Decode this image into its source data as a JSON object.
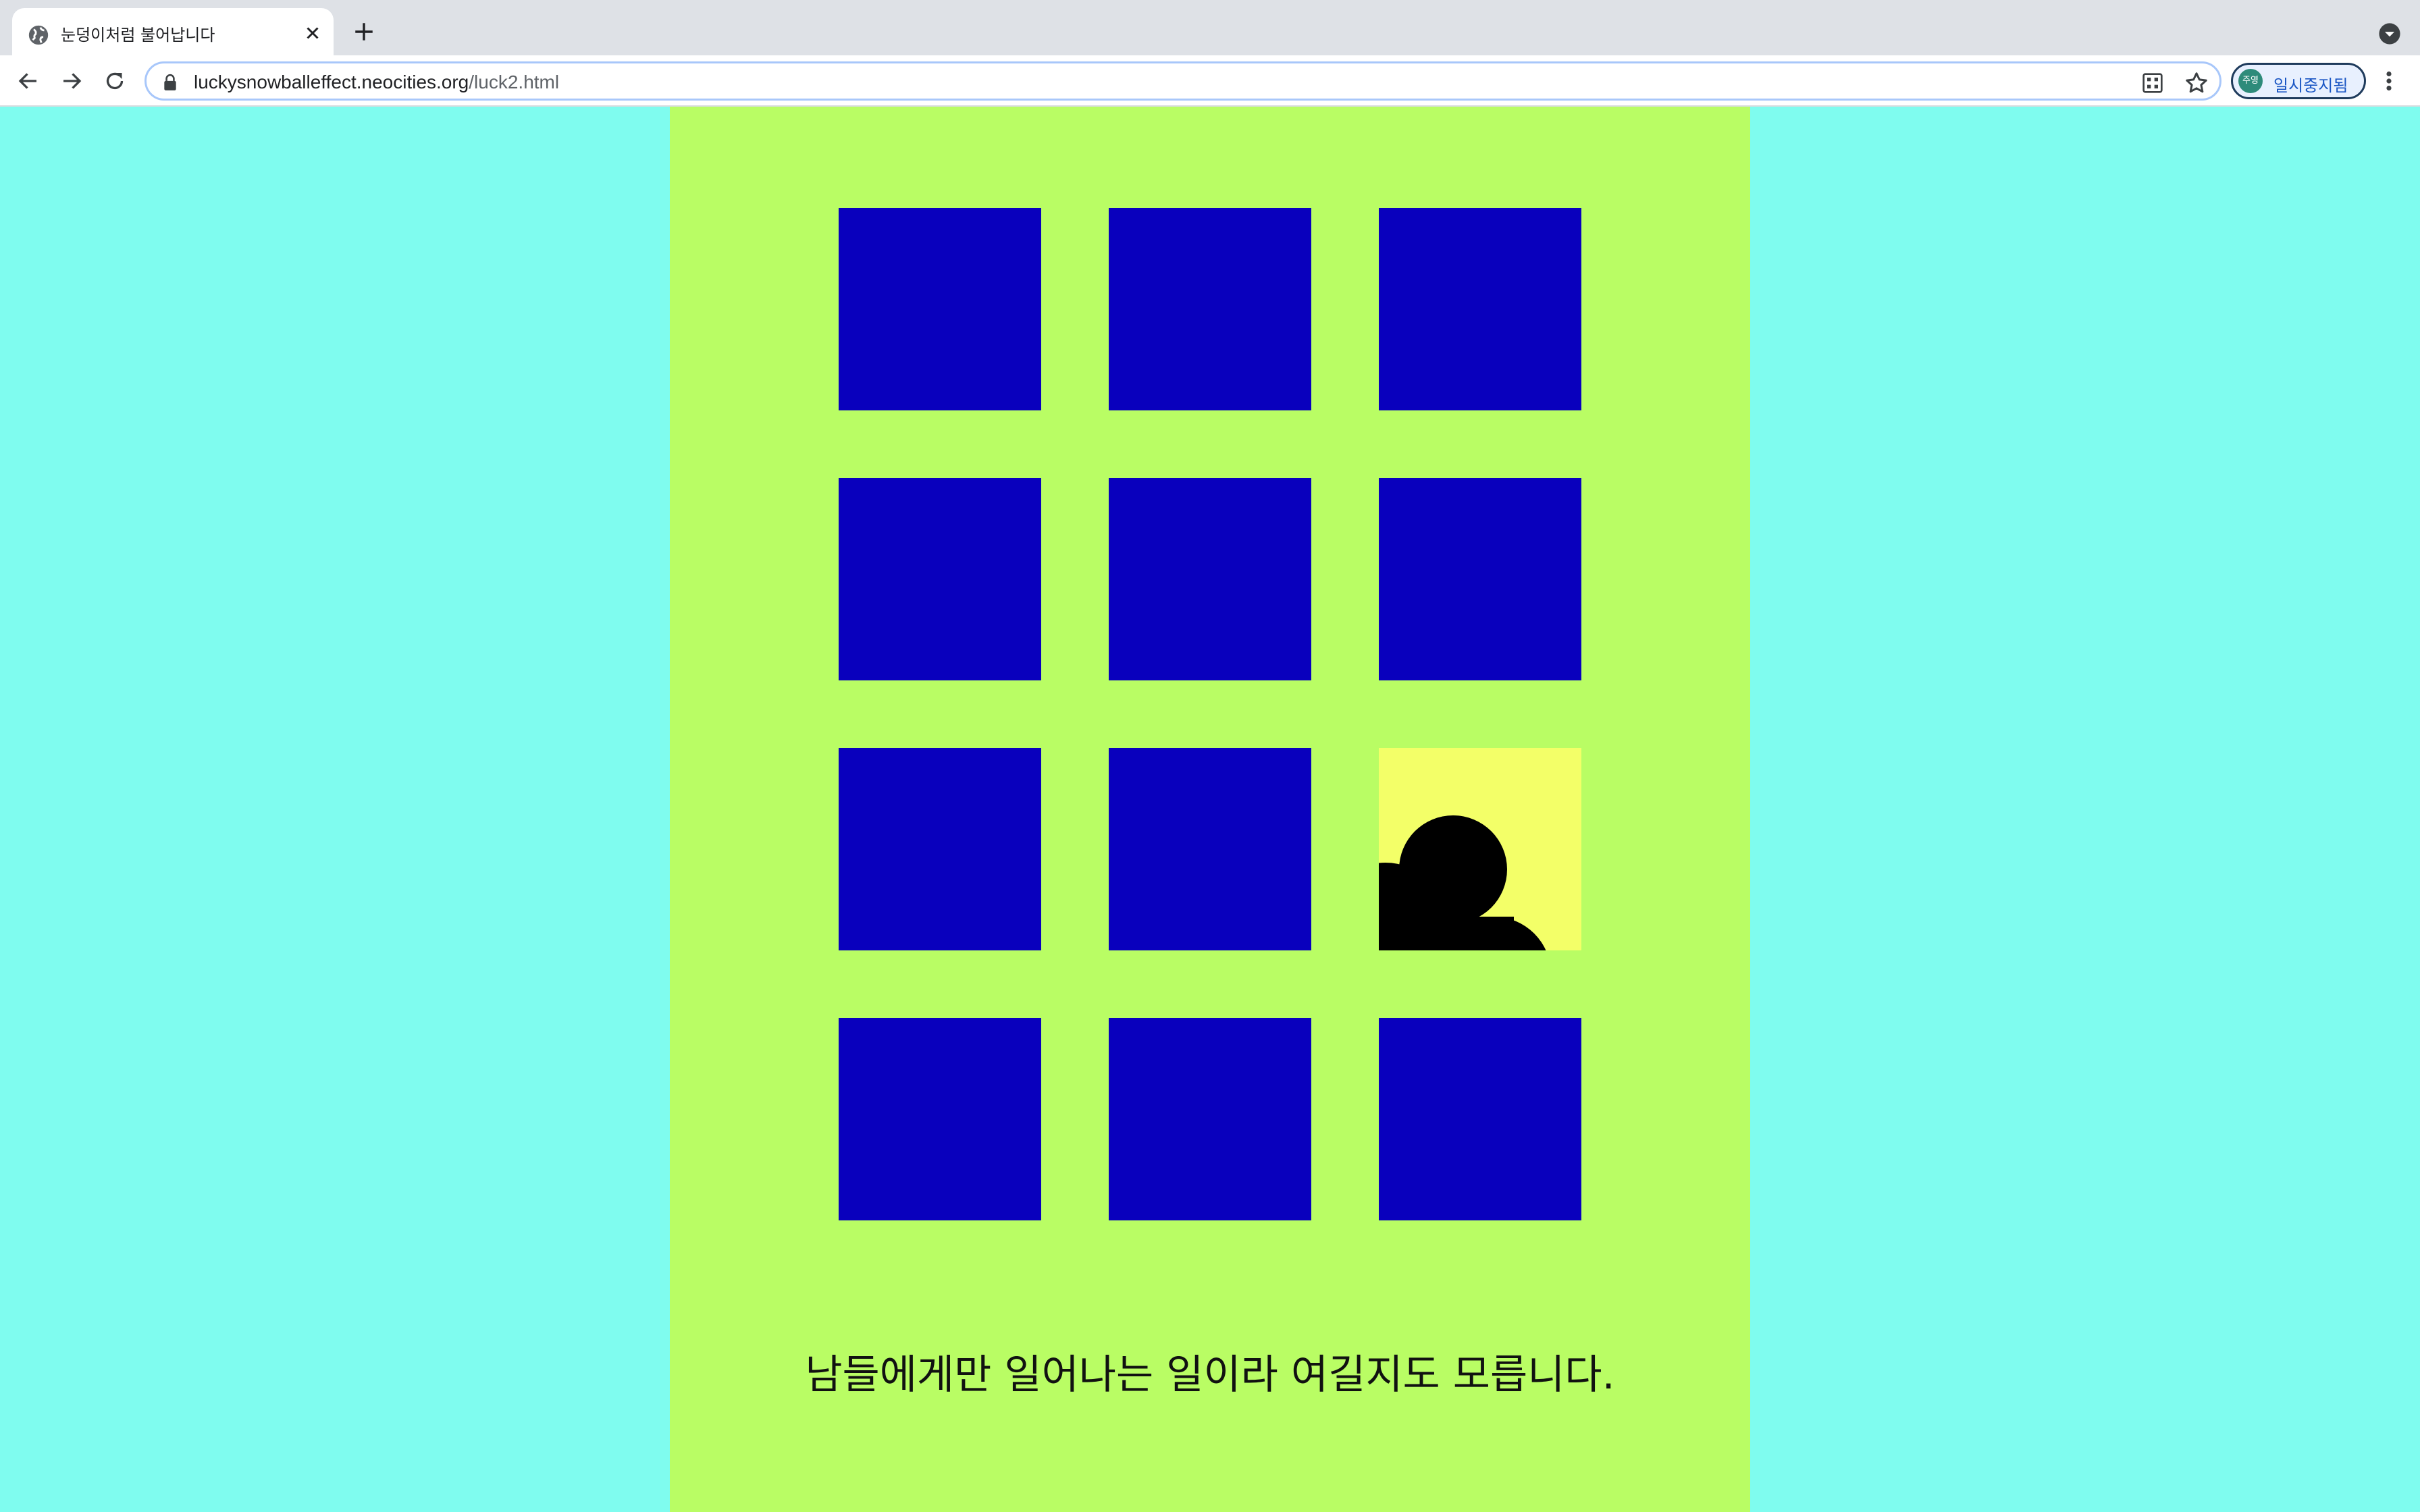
{
  "browser": {
    "tab": {
      "title": "눈덩이처럼 불어납니다",
      "favicon": "globe-icon"
    },
    "address": {
      "host": "luckysnowballeffect.neocities.org",
      "path": "/luck2.html"
    },
    "profile": {
      "avatar_text": "주영",
      "label": "일시중지됨"
    }
  },
  "page": {
    "background_color": "#7ffcef",
    "panel_color": "#b9fd64",
    "tile_color": "#0900bd",
    "revealed_tile_color": "#f3ff68",
    "tiles": [
      {
        "state": "hidden"
      },
      {
        "state": "hidden"
      },
      {
        "state": "hidden"
      },
      {
        "state": "hidden"
      },
      {
        "state": "hidden"
      },
      {
        "state": "hidden"
      },
      {
        "state": "hidden"
      },
      {
        "state": "hidden"
      },
      {
        "state": "revealed",
        "image": "black-cloud-icon"
      },
      {
        "state": "hidden"
      },
      {
        "state": "hidden"
      },
      {
        "state": "hidden"
      }
    ],
    "caption": "남들에게만 일어나는 일이라 여길지도 모릅니다."
  }
}
